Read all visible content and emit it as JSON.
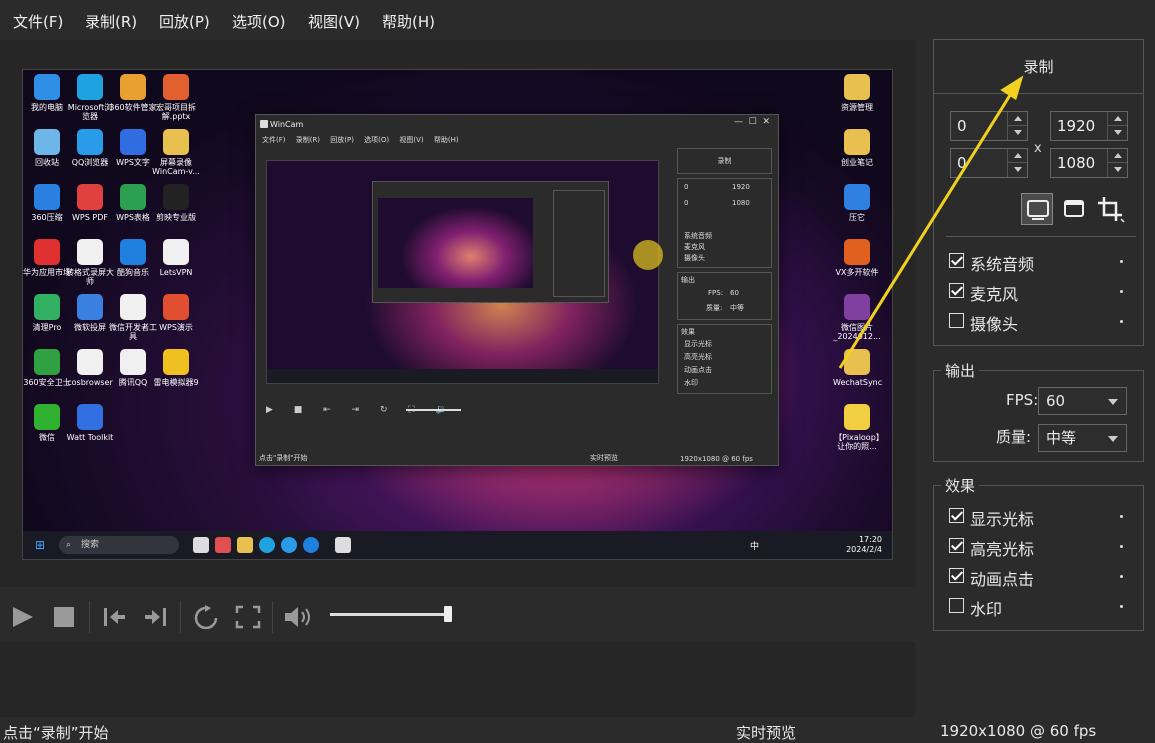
{
  "menubar": {
    "items": [
      "文件(F)",
      "录制(R)",
      "回放(P)",
      "选项(O)",
      "视图(V)",
      "帮助(H)"
    ]
  },
  "preview": {
    "desktop_icons_left": [
      {
        "label": "我的电脑",
        "color": "#2f8ee6"
      },
      {
        "label": "Microsoft浏览器",
        "color": "#1fa3e0"
      },
      {
        "label": "360软件管家",
        "color": "#e8a030"
      },
      {
        "label": "宏哥项目拆解.pptx",
        "color": "#e06030"
      },
      {
        "label": "回收站",
        "color": "#6cb6e8"
      },
      {
        "label": "QQ浏览器",
        "color": "#2a9be8"
      },
      {
        "label": "WPS文字",
        "color": "#2f6de0"
      },
      {
        "label": "屏幕录像WinCam-v...",
        "color": "#e8c050"
      },
      {
        "label": "360压缩",
        "color": "#2a80e0"
      },
      {
        "label": "WPS PDF",
        "color": "#e04040"
      },
      {
        "label": "WPS表格",
        "color": "#2aa050"
      },
      {
        "label": "剪映专业版",
        "color": "#222222"
      },
      {
        "label": "华为应用市场",
        "color": "#e03030"
      },
      {
        "label": "转格式录屏大师",
        "color": "#f0f0f0"
      },
      {
        "label": "酷狗音乐",
        "color": "#1f80e0"
      },
      {
        "label": "LetsVPN",
        "color": "#f0f0f0"
      },
      {
        "label": "清理Pro",
        "color": "#30b060"
      },
      {
        "label": "微软投屏",
        "color": "#3a80e0"
      },
      {
        "label": "微信开发者工具",
        "color": "#f0f0f0"
      },
      {
        "label": "WPS演示",
        "color": "#e05030"
      },
      {
        "label": "360安全卫士",
        "color": "#30a040"
      },
      {
        "label": "cosbrowser",
        "color": "#f0f0f0"
      },
      {
        "label": "腾讯QQ",
        "color": "#f0f0f0"
      },
      {
        "label": "雷电模拟器9",
        "color": "#f0c020"
      },
      {
        "label": "微信",
        "color": "#30b030"
      },
      {
        "label": "Watt Toolkit",
        "color": "#3070e0"
      }
    ],
    "desktop_icons_right": [
      {
        "label": "资源管理",
        "color": "#e8c050"
      },
      {
        "label": "创业笔记",
        "color": "#e8c050"
      },
      {
        "label": "压它",
        "color": "#2f80e0"
      },
      {
        "label": "VX多开软件",
        "color": "#e06020"
      },
      {
        "label": "微信图片_2024012...",
        "color": "#8040a0"
      },
      {
        "label": "WechatSync",
        "color": "#e8c050"
      },
      {
        "label": "【Pixaloop】让你的照...",
        "color": "#f0d040"
      }
    ],
    "taskbar": {
      "search_placeholder": "搜索",
      "tray_lang": "中",
      "time": "17:20",
      "date": "2024/2/4"
    },
    "inner_window": {
      "title": "WinCam",
      "menu": "文件(F) 录制(R) 回放(P) 选项(O) 视图(V) 帮助(H)",
      "record": "录制",
      "w": "1920",
      "h": "1080",
      "x0": "0",
      "y0": "0",
      "audio": [
        "系统音频",
        "麦克风",
        "摄像头"
      ],
      "output_title": "输出",
      "fps_label": "FPS:",
      "fps": "60",
      "quality_label": "质量:",
      "quality": "中等",
      "effects_title": "效果",
      "effects": [
        "显示光标",
        "高亮光标",
        "动画点击",
        "水印"
      ],
      "status_left": "点击\"录制\"开始",
      "status_mid": "实时预览",
      "status_right": "1920x1080 @ 60 fps"
    }
  },
  "controls": {
    "volume_level": 0.97
  },
  "status": {
    "left": "点击“录制”开始",
    "middle": "实时预览",
    "right": "1920x1080 @ 60 fps"
  },
  "right_panel": {
    "record_label": "录制",
    "x": "0",
    "y": "0",
    "width": "1920",
    "height": "1080",
    "times_sign": "x",
    "mode_icons": [
      "monitor-icon",
      "window-icon",
      "crop-icon"
    ],
    "sources": [
      {
        "label": "系统音频",
        "checked": true
      },
      {
        "label": "麦克风",
        "checked": true
      },
      {
        "label": "摄像头",
        "checked": false
      }
    ],
    "output": {
      "title": "输出",
      "fps_label": "FPS:",
      "fps_value": "60",
      "quality_label": "质量:",
      "quality_value": "中等"
    },
    "effects": {
      "title": "效果",
      "items": [
        {
          "label": "显示光标",
          "checked": true
        },
        {
          "label": "高亮光标",
          "checked": true
        },
        {
          "label": "动画点击",
          "checked": true
        },
        {
          "label": "水印",
          "checked": false
        }
      ]
    }
  },
  "colors": {
    "background": "#2b2b2b",
    "panel_border": "#555555",
    "annotation_arrow": "#f0d020"
  }
}
